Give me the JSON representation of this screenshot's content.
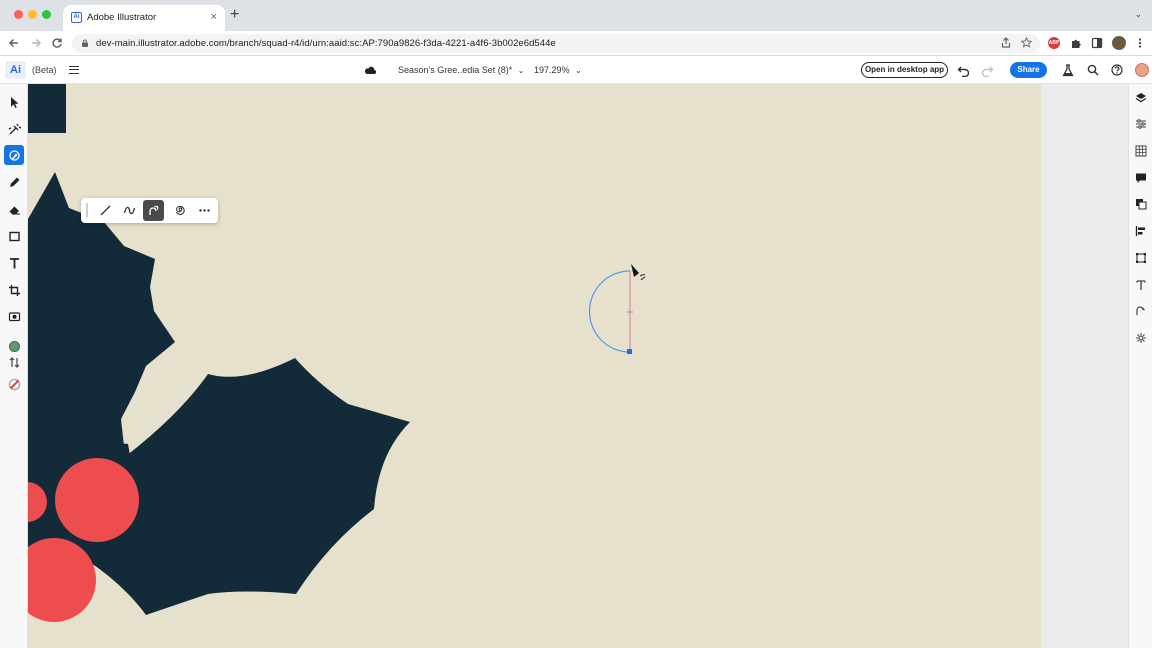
{
  "browser": {
    "tab_title": "Adobe Illustrator",
    "tab_favicon": "Ai",
    "url": "dev-main.illustrator.adobe.com/branch/squad-r4/id/urn:aaid:sc:AP:790a9826-f3da-4221-a4f6-3b002e6d544e",
    "new_tab": "+",
    "close": "×",
    "menu": "⌄"
  },
  "app": {
    "logo": "Ai",
    "beta_label": "(Beta)",
    "document_title": "Season's Gree..edia Set (8)*",
    "zoom": "197.29%",
    "open_desktop_label": "Open in desktop app",
    "share_label": "Share"
  },
  "left_tools": [
    {
      "name": "selection-tool-icon"
    },
    {
      "name": "direct-selection-tool-icon"
    },
    {
      "name": "curvature-pen-tool-icon",
      "active": true
    },
    {
      "name": "pencil-tool-icon"
    },
    {
      "name": "eraser-tool-icon"
    },
    {
      "name": "rectangle-tool-icon"
    },
    {
      "name": "type-tool-icon"
    },
    {
      "name": "crop-tool-icon"
    },
    {
      "name": "image-trace-icon"
    },
    {
      "name": "fill-color-icon"
    },
    {
      "name": "swap-colors-icon"
    },
    {
      "name": "stroke-color-icon"
    }
  ],
  "pen_toolbar": [
    "line-mode-icon",
    "curve-mode-icon",
    "smooth-curve-mode-icon",
    "spiral-icon",
    "more-options-icon"
  ],
  "right_tools": [
    "layers-icon",
    "properties-icon",
    "swatches-icon",
    "comments-icon",
    "duplicate-icon",
    "align-icon",
    "transform-icon",
    "type-icon",
    "path-icon",
    "settings-icon"
  ],
  "colors": {
    "artboard": "#e5e1cd",
    "holly_leaf": "#132a38",
    "berry": "#ee4d4f",
    "path_blue": "#5a9be0",
    "accent": "#1473e6"
  }
}
